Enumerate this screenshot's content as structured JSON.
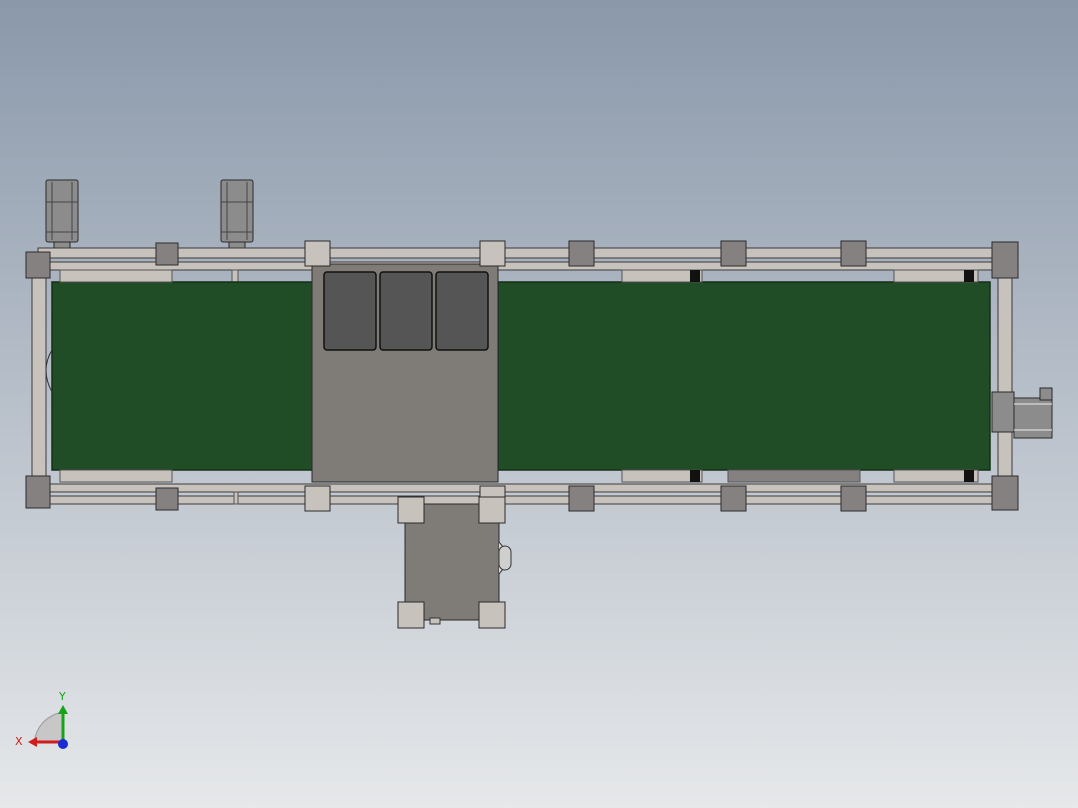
{
  "viewport": {
    "background_top": "#8a98aa",
    "background_bottom": "#e6e8ea"
  },
  "colors": {
    "frame": "#c8c2bc",
    "frame_edge": "#3a3a3a",
    "belt": "#214d26",
    "housing": "#7f7b77",
    "pad": "#555555",
    "bracket": "#858181",
    "motor": "#8c8c8c",
    "accent_black": "#111111"
  },
  "triad": {
    "x_label": "X",
    "y_label": "Y",
    "x_color": "#d11c1c",
    "y_color": "#17a317",
    "z_color": "#1a2ad6"
  }
}
